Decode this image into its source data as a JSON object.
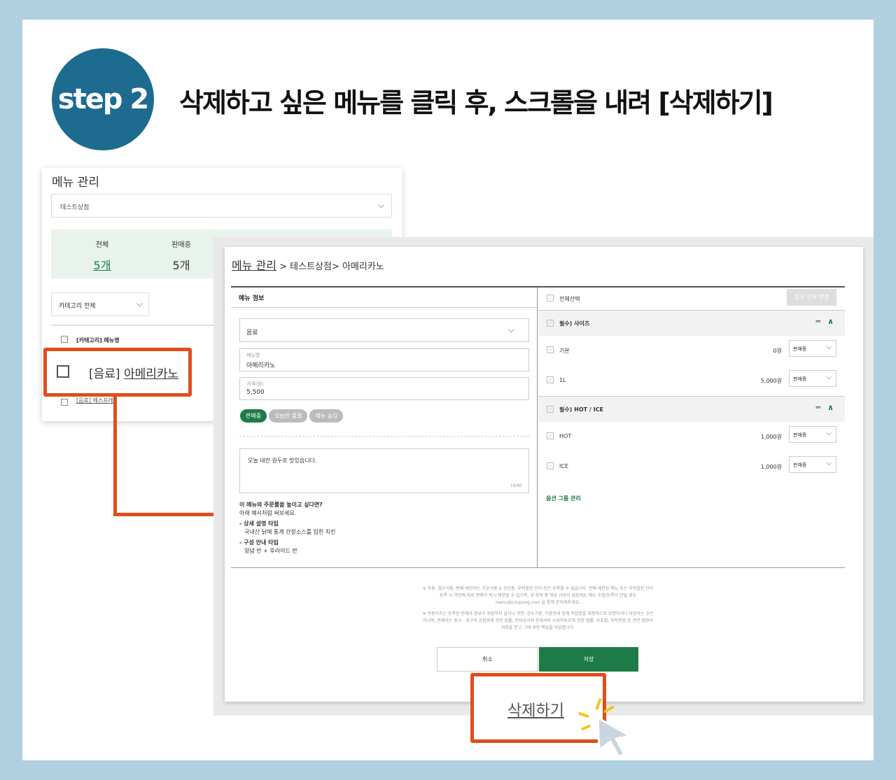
{
  "step": {
    "label": "step 2",
    "headline": "삭제하고 싶은 메뉴를 클릭 후, 스크롤을 내려 [삭제하기]"
  },
  "list_screen": {
    "title": "메뉴 관리",
    "store_select": "테스트상점",
    "summary": [
      {
        "label": "전체",
        "value": "5개"
      },
      {
        "label": "판매중",
        "value": "5개"
      }
    ],
    "category_select": "카테고리 전체",
    "table_header": "[카테고리] 메뉴명",
    "highlight_row": {
      "category": "[음료]",
      "name": "아메리카노"
    },
    "next_row": "[음료] 에스프레"
  },
  "detail_screen": {
    "breadcrumb": {
      "root": "메뉴 관리",
      "sep1": ">",
      "store": "테스트상점",
      "sep2": ">",
      "item": "아메리카노"
    },
    "menu_info_title": "메뉴 정보",
    "category_value": "음료",
    "name_field": {
      "label": "메뉴명",
      "value": "아메리카노"
    },
    "price_field": {
      "label": "가격(원)",
      "value": "5,500"
    },
    "tags": [
      "판매중",
      "오늘만 품절",
      "메뉴 숨김"
    ],
    "description": {
      "text": "오늘 내린 원두로 맛있습니다.",
      "count": "16/60"
    },
    "tips": {
      "question": "이 메뉴의 주문률을 높이고 싶다면?",
      "intro": "아래 예시처럼 써보세요.",
      "type1_title": "- 상세 설명 타입",
      "type1_example": "국내산 닭에 통계 간장소스를 입힌 치킨",
      "type2_title": "- 구성 안내 타입",
      "type2_example": "양념 반 + 후라이드 반"
    },
    "select_all": "전체선택",
    "option_status_button": "옵션 상태 변경",
    "option_groups": [
      {
        "title": "필수) 사이즈",
        "options": [
          {
            "name": "기본",
            "price": "0원",
            "status": "판매중"
          },
          {
            "name": "1L",
            "price": "5,000원",
            "status": "판매중"
          }
        ]
      },
      {
        "title": "필수) HOT / ICE",
        "options": [
          {
            "name": "HOT",
            "price": "1,000원",
            "status": "판매중"
          },
          {
            "name": "ICE",
            "price": "1,000원",
            "status": "판매중"
          }
        ]
      }
    ],
    "option_group_manage": "옵션 그룹 관리",
    "notice1": "※ 주류, 혐오식품, 판매 제한되는 가공식품 & 공산품, 부적절한 단어 등은 등록할 수 없습니다. 판매 제한된 메뉴 또는 부적절한 단어 등록 시 약관에 따라 판매가 즉시 제한될 수 있으며, 위 항목 중 해당 사항이 없음에도 메뉴 수정/등록이 안될 경우 menu@coupang.com 을 통해 문의해주세요.",
    "notice2": "※ 쿠팡이츠는 등록된 판매자 정보가 위법하지 않거나 약관, 검수기준, 이용안내 등에 적합함을 최종적으로 보증하거나 보장하는 것은 아니며, 판매자는 표시 · 광고의 공정화에 관한 법률, 전자상거래 등에서의 소비자보호에 관한 법률, 상표법, 저작권법 등 관련 법령의 적용을 받고 그에 대한 책임을 부담합니다.",
    "cancel_label": "취소",
    "save_label": "저장"
  },
  "delete_label": "삭제하기",
  "colors": {
    "accent": "#e04e1b",
    "brand_green": "#1e7b47",
    "step_blue": "#1d6b8f",
    "background": "#b0cfe0"
  }
}
